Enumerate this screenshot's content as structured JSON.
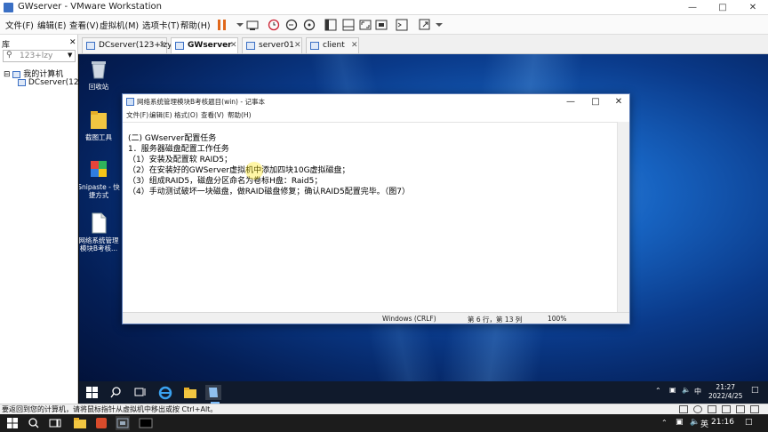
{
  "window": {
    "title": "GWserver - VMware Workstation"
  },
  "menu": [
    "文件(F)",
    "编辑(E)",
    "查看(V)",
    "虚拟机(M)",
    "选项卡(T)",
    "帮助(H)"
  ],
  "library": {
    "header": "库",
    "search_placeholder": "123+lzy",
    "tree_root": "我的计算机",
    "tree_child": "DCserver(12"
  },
  "tabs": [
    {
      "label": "DCserver(123+lzy)",
      "active": false
    },
    {
      "label": "GWserver",
      "active": true
    },
    {
      "label": "server01",
      "active": false
    },
    {
      "label": "client",
      "active": false
    }
  ],
  "desktop_icons": [
    {
      "label": "回收站",
      "icon": "recycle-bin-icon"
    },
    {
      "label": "截图工具",
      "icon": "folder-icon"
    },
    {
      "label": "Snipaste - 快捷方式",
      "icon": "snipaste-icon"
    },
    {
      "label": "网络系统管理模块B考核...",
      "icon": "text-file-icon"
    }
  ],
  "notepad": {
    "title": "网络系统管理模块B考核题目(win) - 记事本",
    "menu": [
      "文件(F)",
      "编辑(E)",
      "格式(O)",
      "查看(V)",
      "帮助(H)"
    ],
    "lines": [
      "(二)  GWserver配置任务",
      "1．服务器磁盘配置工作任务",
      "（1）安装及配置软 RAID5；",
      "（2）在安装好的GWServer虚拟机中添加四块10G虚拟磁盘；",
      "（3）组成RAID5，磁盘分区命名为卷标H盘：Raid5；",
      "（4）手动测试破坏一块磁盘，做RAID磁盘修复；确认RAID5配置完毕。（图7）"
    ],
    "status": {
      "encoding": "Windows (CRLF)",
      "position": "第 6 行，第 13 列",
      "zoom": "100%"
    }
  },
  "guest_taskbar": {
    "time": "21:27",
    "date": "2022/4/25",
    "ime": "中"
  },
  "vm_status": "要返回到您的计算机，请将鼠标指针从虚拟机中移出或按 Ctrl+Alt。",
  "host_taskbar": {
    "ime": "英",
    "time": "21:16"
  }
}
